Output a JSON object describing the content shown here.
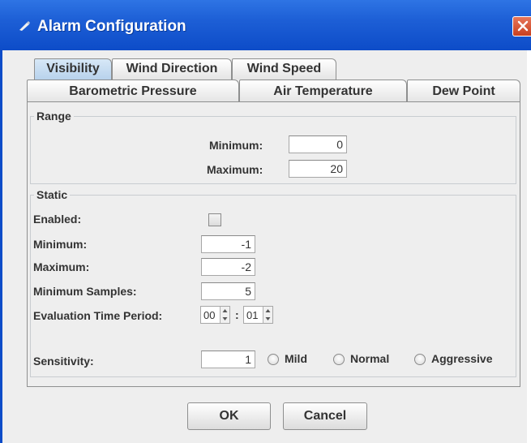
{
  "window": {
    "title": "Alarm Configuration",
    "title_icon": "pen-icon",
    "close_icon": "close-icon",
    "titlebar_color": "#1d5fd6",
    "close_color": "#d6502d"
  },
  "tabs": {
    "row1": [
      "Visibility",
      "Wind Direction",
      "Wind Speed"
    ],
    "row2": [
      "Barometric Pressure",
      "Air Temperature",
      "Dew Point"
    ],
    "selected": "Visibility"
  },
  "range": {
    "legend": "Range",
    "minimum_label": "Minimum:",
    "minimum_value": "0",
    "maximum_label": "Maximum:",
    "maximum_value": "20"
  },
  "static": {
    "legend": "Static",
    "enabled_label": "Enabled:",
    "enabled": false,
    "minimum_label": "Minimum:",
    "minimum_value": "-1",
    "maximum_label": "Maximum:",
    "maximum_value": "-2",
    "min_samples_label": "Minimum Samples:",
    "min_samples_value": "5",
    "eval_period_label": "Evaluation Time Period:",
    "eval_hours": "00",
    "eval_separator": ":",
    "eval_minutes": "01",
    "sensitivity_label": "Sensitivity:",
    "sensitivity_value": "1",
    "sensitivity_options": [
      "Mild",
      "Normal",
      "Aggressive"
    ]
  },
  "buttons": {
    "ok": "OK",
    "cancel": "Cancel"
  }
}
